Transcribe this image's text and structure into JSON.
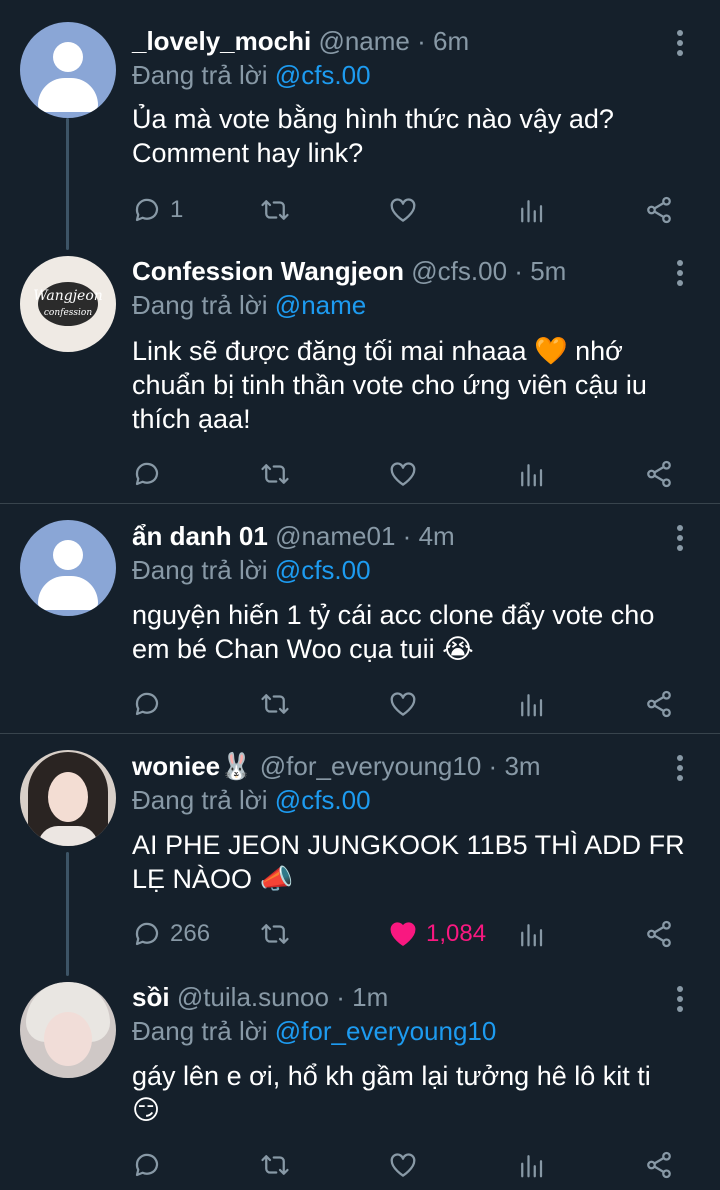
{
  "reply_prefix": "Đang trả lời",
  "tweets": [
    {
      "name": "_lovely_mochi",
      "handle": "@name",
      "time": "6m",
      "reply_to": "@cfs.00",
      "text_lines": [
        "Ủa mà vote bằng hình thức nào vậy ad?",
        "Comment hay link?"
      ],
      "reply_count": "1",
      "like_count": "",
      "avatar": "default-avatar"
    },
    {
      "name": "Confession Wangjeon",
      "handle": "@cfs.00",
      "time": "5m",
      "reply_to": "@name",
      "text_lines": [
        "Link sẽ được đăng tối mai nhaaa 🧡 nhớ",
        "chuẩn bị tinh thần vote cho ứng viên cậu iu",
        "thích ạaa!"
      ],
      "reply_count": "",
      "like_count": "",
      "avatar": "wangjeon-logo",
      "logo_text": "Wangjeon",
      "logo_sub": "confession"
    },
    {
      "name": "ẩn danh 01",
      "handle": "@name01",
      "time": "4m",
      "reply_to": "@cfs.00",
      "text_lines": [
        "nguyện hiến 1 tỷ cái acc clone đẩy vote cho",
        "em bé Chan Woo cụa tuii 😭"
      ],
      "reply_count": "",
      "like_count": "",
      "avatar": "default-avatar"
    },
    {
      "name": "woniee🐰",
      "handle": "@for_everyoung10",
      "time": "3m",
      "reply_to": "@cfs.00",
      "text_lines": [
        "AI PHE JEON JUNGKOOK 11B5 THÌ ADD FR",
        "LẸ NÀOO 📣"
      ],
      "reply_count": "266",
      "like_count": "1,084",
      "liked": true,
      "avatar": "photo-dark-hair"
    },
    {
      "name": "sồi",
      "handle": "@tuila.sunoo",
      "time": "1m",
      "reply_to": "@for_everyoung10",
      "text_lines": [
        "gáy lên e ơi, hổ kh gầm lại tưởng hê lô kit ti",
        "😏"
      ],
      "reply_count": "",
      "like_count": "",
      "avatar": "photo-light-hair"
    }
  ],
  "colors": {
    "background": "#15202b",
    "secondary_text": "#8899a6",
    "mention": "#1d9bf0",
    "like": "#f91880",
    "divider": "#38444d"
  }
}
